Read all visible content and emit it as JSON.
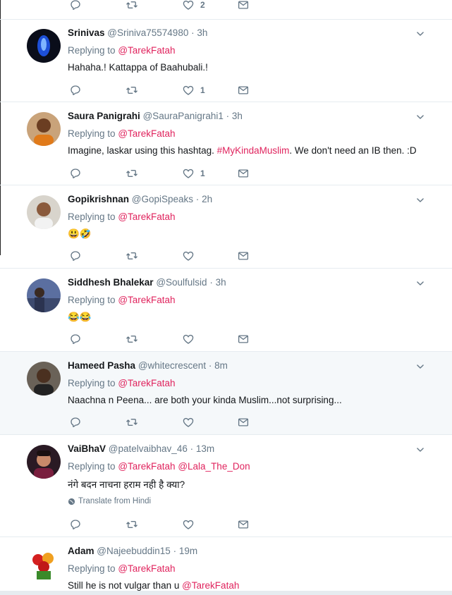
{
  "top_actions": {
    "like_count": "2"
  },
  "tweets": [
    {
      "name": "Srinivas",
      "handle": "@Sriniva75574980",
      "time": "3h",
      "replying_label": "Replying to",
      "mentions": [
        "@TarekFatah"
      ],
      "text": "Hahaha.! Kattappa of Baahubali.!",
      "like_count": "1"
    },
    {
      "name": "Saura Panigrahi",
      "handle": "@SauraPanigrahi1",
      "time": "3h",
      "replying_label": "Replying to",
      "mentions": [
        "@TarekFatah"
      ],
      "text_pre": "Imagine, laskar using this hashtag. ",
      "hashtag": "#MyKindaMuslim",
      "text_post": ". We don't need an IB then. :D",
      "like_count": "1"
    },
    {
      "name": "Gopikrishnan",
      "handle": "@GopiSpeaks",
      "time": "2h",
      "replying_label": "Replying to",
      "mentions": [
        "@TarekFatah"
      ],
      "text": "😃🤣",
      "like_count": ""
    },
    {
      "name": "Siddhesh Bhalekar",
      "handle": "@Soulfulsid",
      "time": "3h",
      "replying_label": "Replying to",
      "mentions": [
        "@TarekFatah"
      ],
      "text": "😂😂",
      "like_count": ""
    },
    {
      "name": "Hameed Pasha",
      "handle": "@whitecrescent",
      "time": "8m",
      "replying_label": "Replying to",
      "mentions": [
        "@TarekFatah"
      ],
      "text": "Naachna n Peena... are both your kinda Muslim...not surprising...",
      "like_count": ""
    },
    {
      "name": "VaiBhaV",
      "handle": "@patelvaibhav_46",
      "time": "13m",
      "replying_label": "Replying to",
      "mentions": [
        "@TarekFatah",
        "@Lala_The_Don"
      ],
      "text": "नंगे बदन नाचना हराम नही है क्या?",
      "translate": "Translate from Hindi",
      "like_count": ""
    },
    {
      "name": "Adam",
      "handle": "@Najeebuddin15",
      "time": "19m",
      "replying_label": "Replying to",
      "mentions": [
        "@TarekFatah"
      ],
      "text_pre": "Still he is not vulgar than u ",
      "text_mention": "@TarekFatah"
    }
  ],
  "icon_names": [
    "reply-icon",
    "retweet-icon",
    "like-icon",
    "message-icon",
    "chevron-down-icon",
    "globe-icon"
  ],
  "colors": {
    "accent": "#e0245e",
    "muted": "#657786",
    "divider": "#e6ecf0",
    "highlight": "#f5f8fa"
  }
}
